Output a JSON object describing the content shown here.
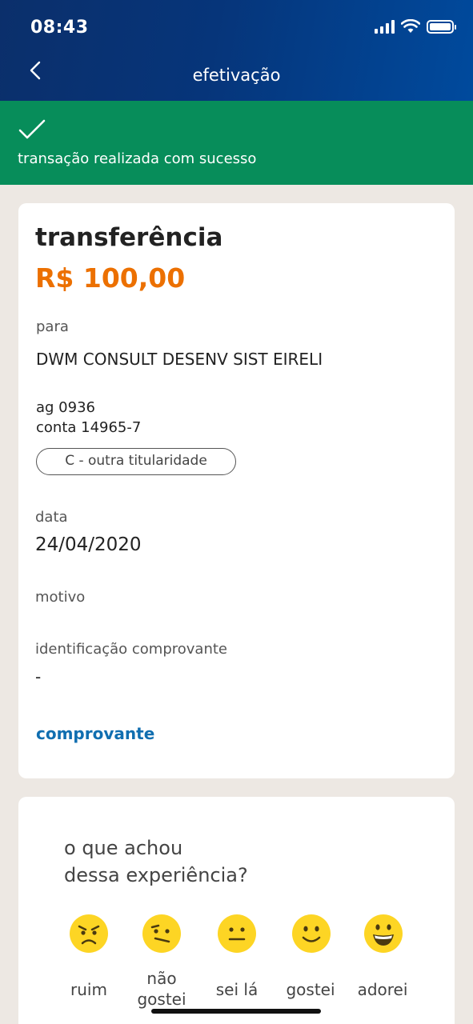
{
  "status_bar": {
    "time": "08:43"
  },
  "header": {
    "title": "efetivação",
    "back_icon": "chevron-left-icon"
  },
  "banner": {
    "icon": "check-icon",
    "message": "transação realizada com sucesso",
    "color": "#078d5a"
  },
  "transfer": {
    "title": "transferência",
    "amount": "R$ 100,00",
    "amount_color": "#ec7000",
    "to_label": "para",
    "recipient": "DWM CONSULT DESENV SIST EIRELI",
    "agency": "ag 0936",
    "account": "conta 14965-7",
    "account_type": "C - outra titularidade",
    "date_label": "data",
    "date": "24/04/2020",
    "reason_label": "motivo",
    "id_label": "identificação comprovante",
    "id_value": "-",
    "receipt_link": "comprovante"
  },
  "feedback": {
    "question_line1": "o que achou",
    "question_line2": "dessa experiência?",
    "options": [
      {
        "label": "ruim",
        "icon": "angry-face-icon"
      },
      {
        "label": "não gostei",
        "icon": "confused-face-icon"
      },
      {
        "label": "sei lá",
        "icon": "neutral-face-icon"
      },
      {
        "label": "gostei",
        "icon": "slight-smile-face-icon"
      },
      {
        "label": "adorei",
        "icon": "grin-face-icon"
      }
    ]
  }
}
